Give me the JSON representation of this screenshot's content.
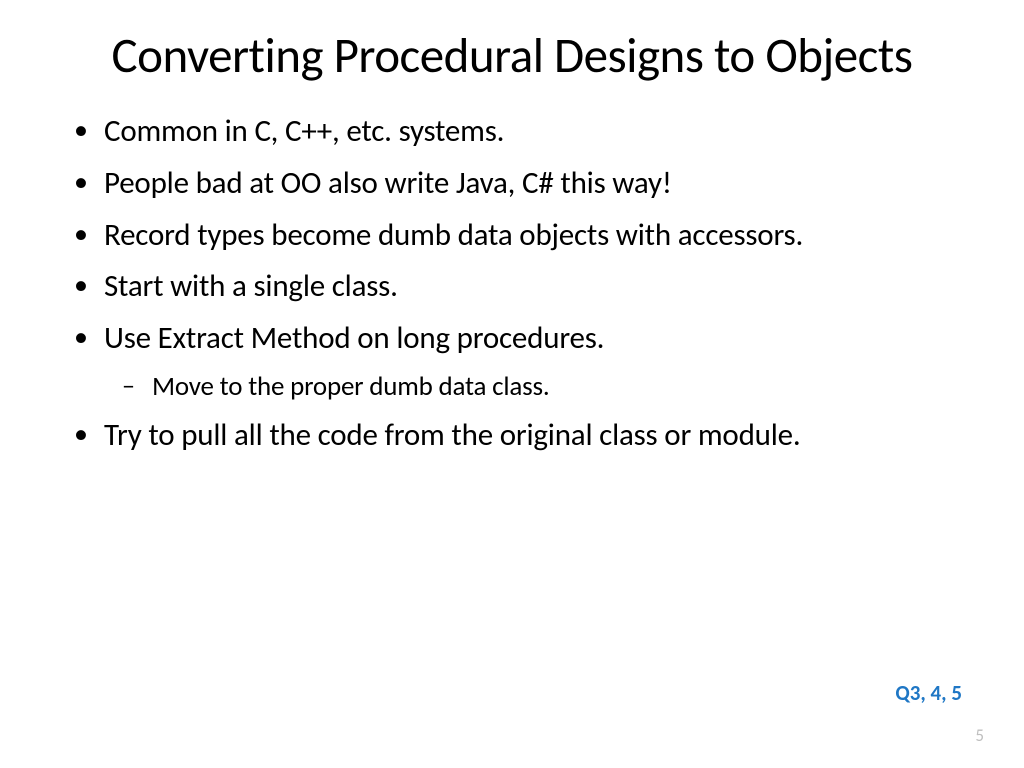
{
  "title": "Converting Procedural Designs to Objects",
  "bullets": {
    "b1": "Common in C, C++, etc. systems.",
    "b2": "People bad at OO also write Java, C# this way!",
    "b3": "Record types become dumb data objects with accessors.",
    "b4": "Start with a single class.",
    "b5": "Use Extract Method on long procedures.",
    "b5s1": "Move to the proper dumb data class.",
    "b6": "Try to pull all the code from the original class or module."
  },
  "footerNote": "Q3, 4, 5",
  "pageNumber": "5"
}
